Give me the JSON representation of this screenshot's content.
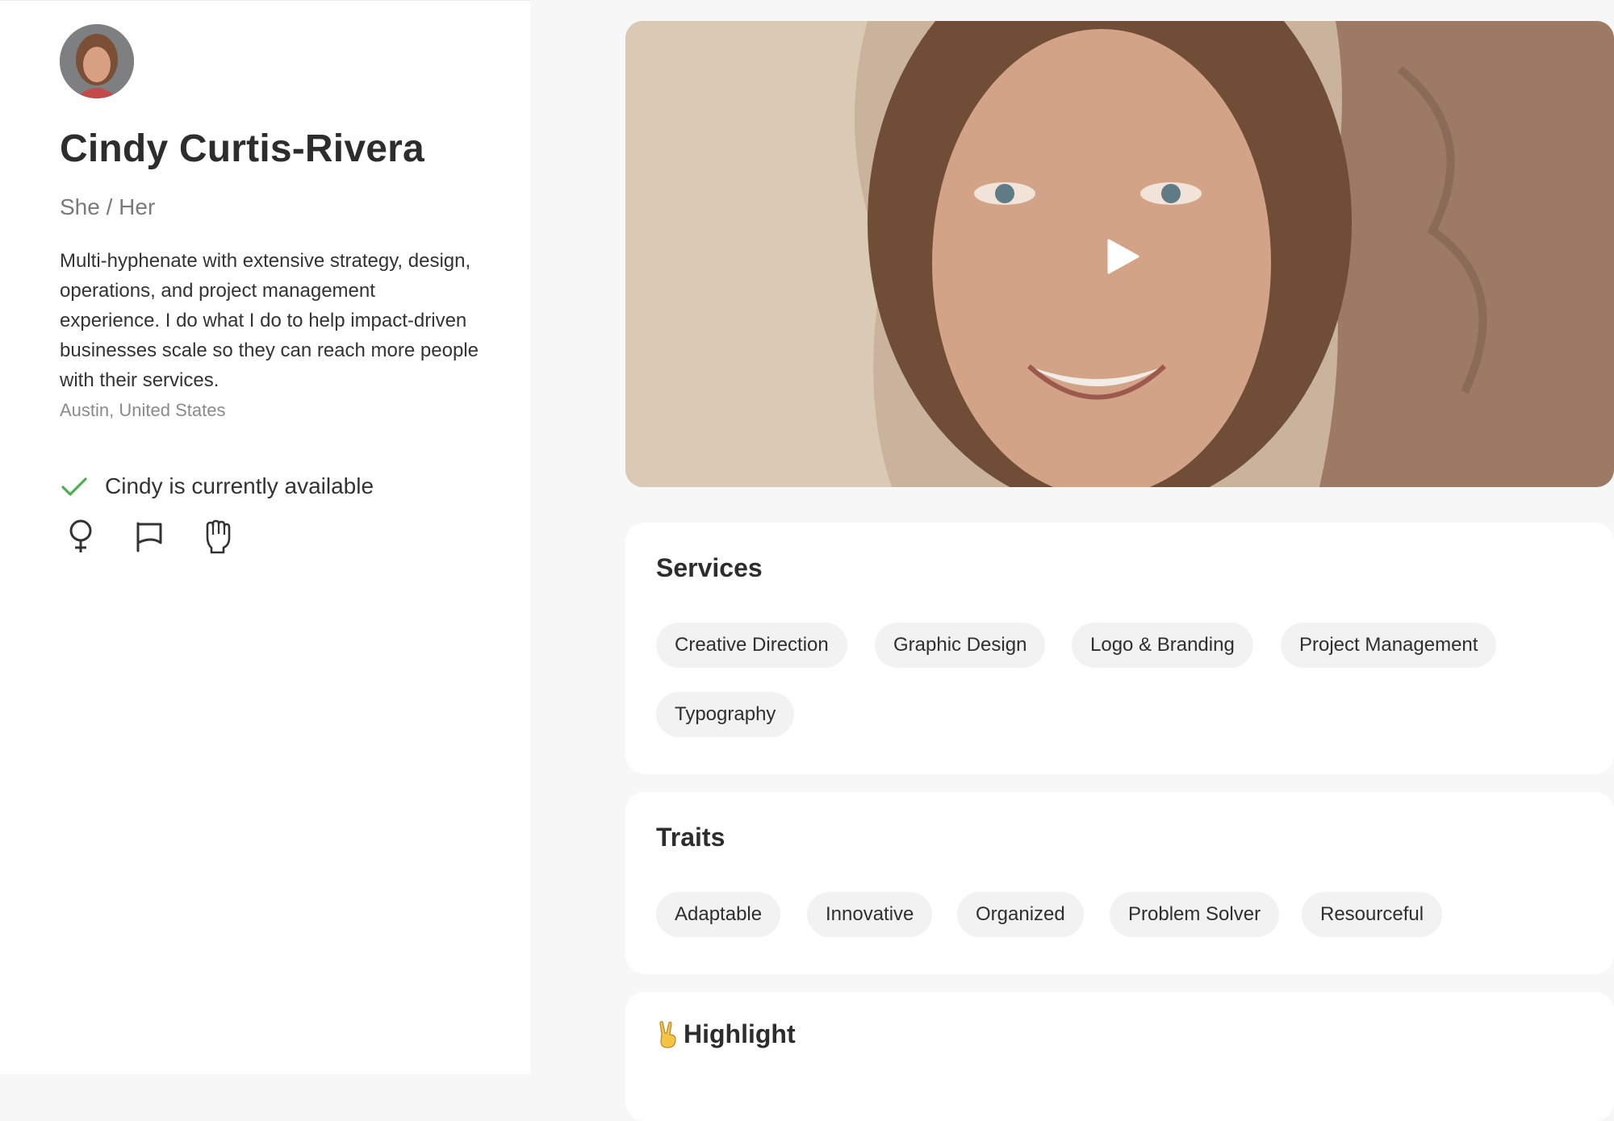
{
  "profile": {
    "name": "Cindy Curtis-Rivera",
    "pronouns": "She / Her",
    "bio": "Multi-hyphenate with extensive strategy, design, operations, and project management experience. I do what I do to help impact-driven businesses scale so they can reach more people with their services.",
    "location": "Austin, United States",
    "availability": "Cindy is currently available",
    "identity_icons": [
      "female-symbol-icon",
      "flag-icon",
      "raised-fist-icon"
    ]
  },
  "video": {
    "play_icon": "play-icon"
  },
  "services": {
    "title": "Services",
    "items": [
      "Creative Direction",
      "Graphic Design",
      "Logo & Branding",
      "Project Management",
      "Typography"
    ]
  },
  "traits": {
    "title": "Traits",
    "items": [
      "Adaptable",
      "Innovative",
      "Organized",
      "Problem Solver",
      "Resourceful"
    ]
  },
  "highlight": {
    "title": "Highlight",
    "emoji": "victory-hand-icon"
  },
  "colors": {
    "available_check": "#4caf50",
    "pill_bg": "#f2f2f2",
    "page_bg": "#f7f7f7"
  }
}
